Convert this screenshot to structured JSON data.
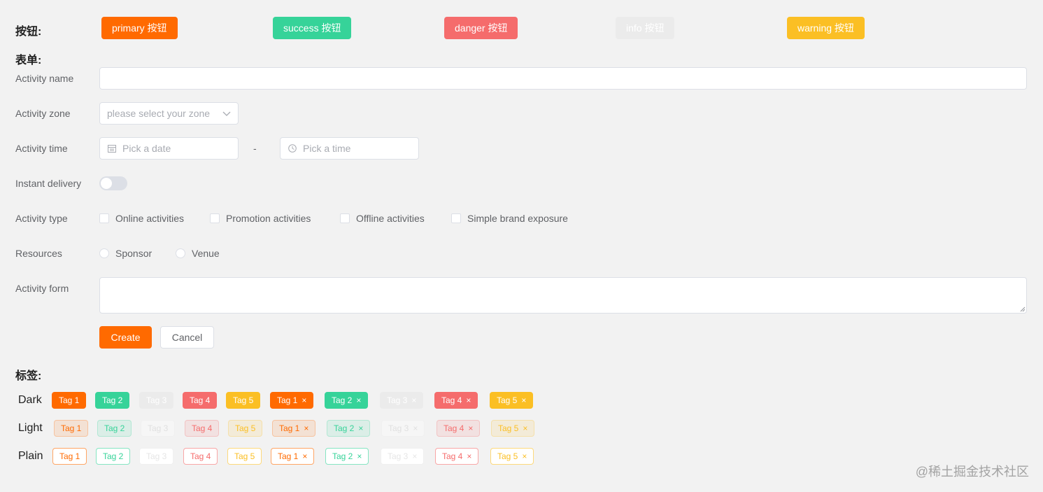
{
  "colors": {
    "primary": "#ff6a00",
    "success": "#36d399",
    "danger": "#f56c6c",
    "info": "#ebebeb",
    "warning": "#fbbf24"
  },
  "sections": {
    "buttons": "按钮:",
    "form": "表单:",
    "tags": "标签:"
  },
  "buttons": [
    {
      "label": "primary 按钮",
      "type": "primary"
    },
    {
      "label": "success 按钮",
      "type": "success"
    },
    {
      "label": "danger 按钮",
      "type": "danger"
    },
    {
      "label": "info 按钮",
      "type": "info"
    },
    {
      "label": "warning 按钮",
      "type": "warning"
    }
  ],
  "form": {
    "name_label": "Activity name",
    "name_value": "",
    "zone_label": "Activity zone",
    "zone_placeholder": "please select your zone",
    "time_label": "Activity time",
    "date_placeholder": "Pick a date",
    "time_separator": "-",
    "time_placeholder": "Pick a time",
    "delivery_label": "Instant delivery",
    "delivery_on": false,
    "type_label": "Activity type",
    "types": [
      "Online activities",
      "Promotion activities",
      "Offline activities",
      "Simple brand exposure"
    ],
    "resources_label": "Resources",
    "resources": [
      "Sponsor",
      "Venue"
    ],
    "form_label": "Activity form",
    "create_label": "Create",
    "cancel_label": "Cancel"
  },
  "tags": {
    "rows": [
      {
        "label": "Dark",
        "effect": "dark"
      },
      {
        "label": "Light",
        "effect": "light"
      },
      {
        "label": "Plain",
        "effect": "plain"
      }
    ],
    "items": [
      "Tag 1",
      "Tag 2",
      "Tag 3",
      "Tag 4",
      "Tag 5"
    ],
    "close_glyph": "×"
  },
  "watermark": "@稀土掘金技术社区"
}
